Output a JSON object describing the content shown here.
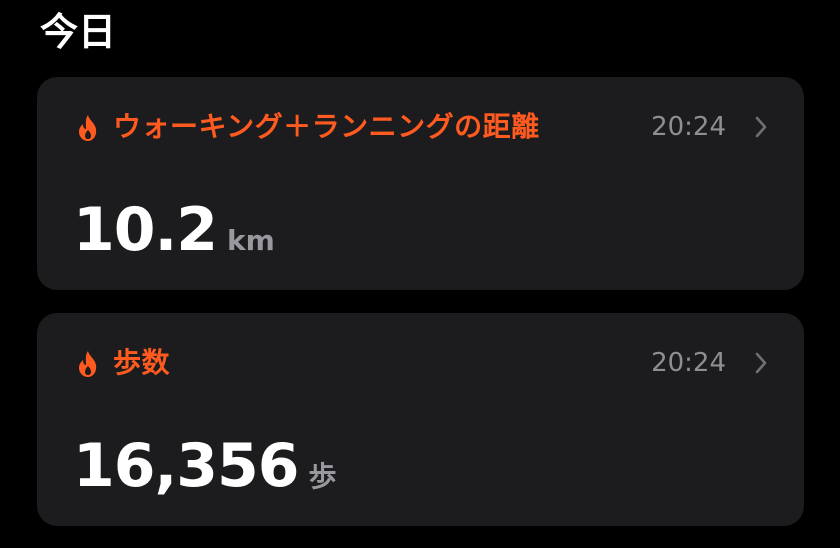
{
  "section": {
    "title": "今日"
  },
  "colors": {
    "accent": "#ff5a1f",
    "card_background": "#1c1c1e",
    "secondary_text": "#8e8e93"
  },
  "cards": [
    {
      "icon": "flame-icon",
      "title": "ウォーキング＋ランニングの距離",
      "time": "20:24",
      "value": "10.2",
      "unit": "km"
    },
    {
      "icon": "flame-icon",
      "title": "歩数",
      "time": "20:24",
      "value": "16,356",
      "unit": "歩"
    }
  ]
}
